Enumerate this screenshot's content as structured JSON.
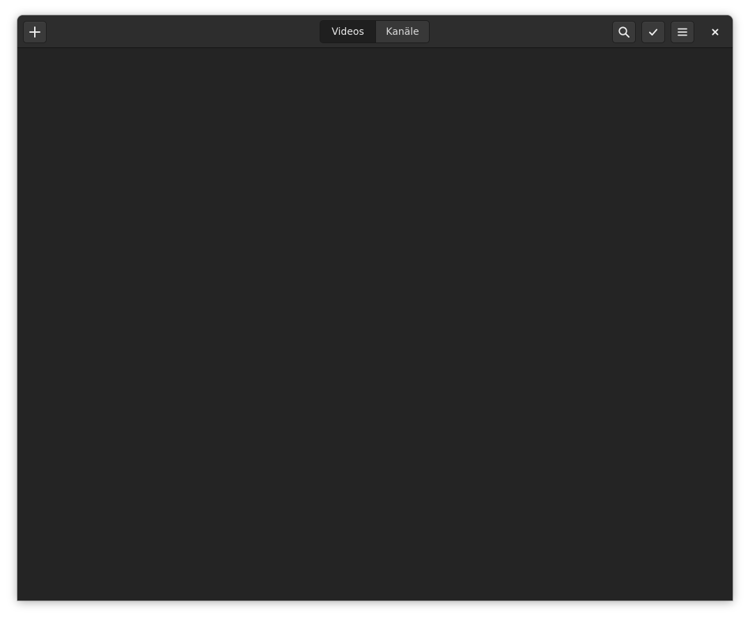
{
  "header": {
    "tabs": [
      {
        "label": "Videos",
        "selected": true
      },
      {
        "label": "Kanäle",
        "selected": false
      }
    ],
    "buttons": {
      "add_icon": "plus-icon",
      "search_icon": "search-icon",
      "select_icon": "checkmark-icon",
      "menu_icon": "hamburger-menu-icon",
      "close_icon": "close-icon"
    }
  },
  "colors": {
    "window_bg": "#242424",
    "headerbar_bg": "#2d2d2d",
    "button_bg": "#3a3a3a",
    "selected_tab_bg": "#1f1f1f",
    "text": "#eeeeee"
  }
}
